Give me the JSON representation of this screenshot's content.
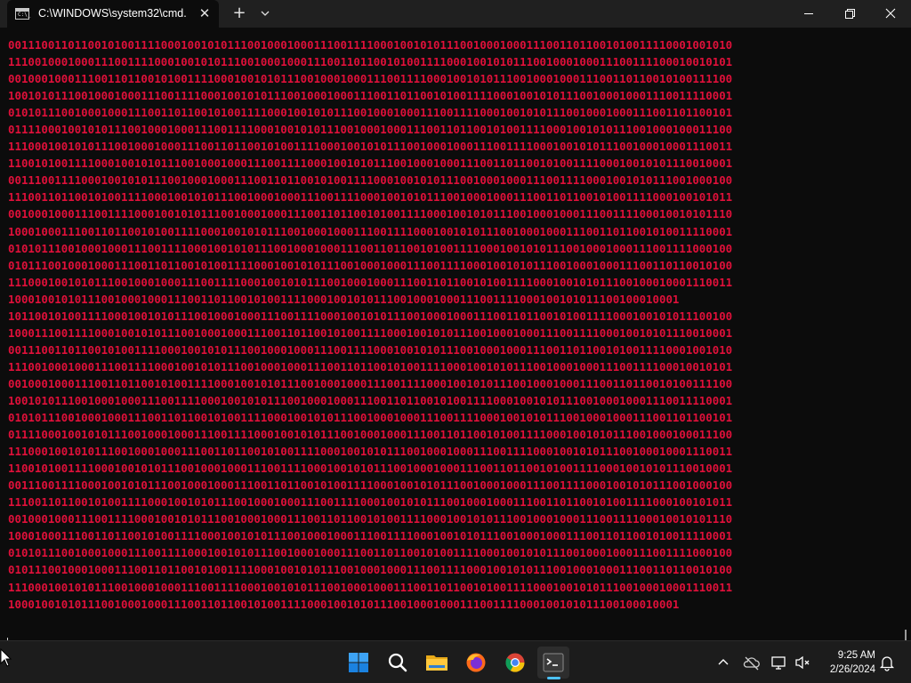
{
  "window": {
    "tab_title": "C:\\WINDOWS\\system32\\cmd.",
    "tab_icon_text": "C:\\_",
    "icons": {
      "tab": "cmd-icon",
      "close_tab": "close-icon",
      "new_tab": "plus-icon",
      "dropdown": "chevron-down-icon",
      "minimize": "minimize-icon",
      "maximize": "restore-icon",
      "close": "close-icon"
    }
  },
  "terminal": {
    "text_color": "#e0103a",
    "background": "#0c0c0c",
    "lines": [
      "0011100110110010100111100010010101110010001000111001111000100101011100100010001110011011001010011110001001010",
      "1110010001000111001111000100101011100100010001110011011001010011110001001010111001000100011100111100010010101",
      "0010001000111001101100101001111000100101011100100010001110011110001001010111001000100011100110110010100111100",
      "1001010111001000100011100111100010010101110010001000111001101100101001111000100101011100100010001110011110001",
      "0101011100100010001110011011001010011110001001010111001000100011100111100010010101110010001000111001101100101",
      "0111100010010101110010001000111001111000100101011100100010001110011011001010011110001001010111001000100011100",
      "1110001001010111001000100011100110110010100111100010010101110010001000111001111000100101011100100010001110011",
      "1100101001111000100101011100100010001110011110001001010111001000100011100110110010100111100010010101110010001",
      "0011100111100010010101110010001000111001101100101001111000100101011100100010001110011110001001010111001000100",
      "1110011011001010011110001001010111001000100011100111100010010101110010001000111001101100101001111000100101011",
      "0010001000111001111000100101011100100010001110011011001010011110001001010111001000100011100111100010010101110",
      "1000100011100110110010100111100010010101110010001000111001111000100101011100100010001110011011001010011110001",
      "0101011100100010001110011110001001010111001000100011100110110010100111100010010101110010001000111001111000100",
      "0101110010001000111001101100101001111000100101011100100010001110011110001001010111001000100011100110110010100",
      "1110001001010111001000100011100111100010010101110010001000111001101100101001111000100101011100100010001110011",
      "10001001010111001000100011100110110010100111100010010101110010001000111001111000100101011100100010001",
      "1011001010011110001001010111001000100011100111100010010101110010001000111001101100101001111000100101011100100",
      "1000111001111000100101011100100010001110011011001010011110001001010111001000100011100111100010010101110010001",
      "0011100110110010100111100010010101110010001000111001111000100101011100100010001110011011001010011110001001010",
      "1110010001000111001111000100101011100100010001110011011001010011110001001010111001000100011100111100010010101",
      "0010001000111001101100101001111000100101011100100010001110011110001001010111001000100011100110110010100111100",
      "1001010111001000100011100111100010010101110010001000111001101100101001111000100101011100100010001110011110001",
      "0101011100100010001110011011001010011110001001010111001000100011100111100010010101110010001000111001101100101",
      "0111100010010101110010001000111001111000100101011100100010001110011011001010011110001001010111001000100011100",
      "1110001001010111001000100011100110110010100111100010010101110010001000111001111000100101011100100010001110011",
      "1100101001111000100101011100100010001110011110001001010111001000100011100110110010100111100010010101110010001",
      "0011100111100010010101110010001000111001101100101001111000100101011100100010001110011110001001010111001000100",
      "1110011011001010011110001001010111001000100011100111100010010101110010001000111001101100101001111000100101011",
      "0010001000111001111000100101011100100010001110011011001010011110001001010111001000100011100111100010010101110",
      "1000100011100110110010100111100010010101110010001000111001111000100101011100100010001110011011001010011110001",
      "0101011100100010001110011110001001010111001000100011100110110010100111100010010101110010001000111001111000100",
      "0101110010001000111001101100101001111000100101011100100010001110011110001001010111001000100011100110110010100",
      "1110001001010111001000100011100111100010010101110010001000111001101100101001111000100101011100100010001110011",
      "10001001010111001000100011100110110010100111100010010101110010001000111001111000100101011100100010001"
    ]
  },
  "taskbar": {
    "apps": [
      {
        "name": "start-icon",
        "active": false
      },
      {
        "name": "search-icon",
        "active": false
      },
      {
        "name": "file-explorer-icon",
        "active": false
      },
      {
        "name": "firefox-icon",
        "active": false
      },
      {
        "name": "chrome-icon",
        "active": false
      },
      {
        "name": "terminal-icon",
        "active": true
      }
    ],
    "tray_icons": [
      "chevron-up-icon",
      "cloud-offline-icon",
      "network-icon",
      "volume-muted-icon",
      "notification-bell-icon"
    ],
    "time": "9:25 AM",
    "date": "2/26/2024",
    "accent_color": "#4cc2ff"
  }
}
